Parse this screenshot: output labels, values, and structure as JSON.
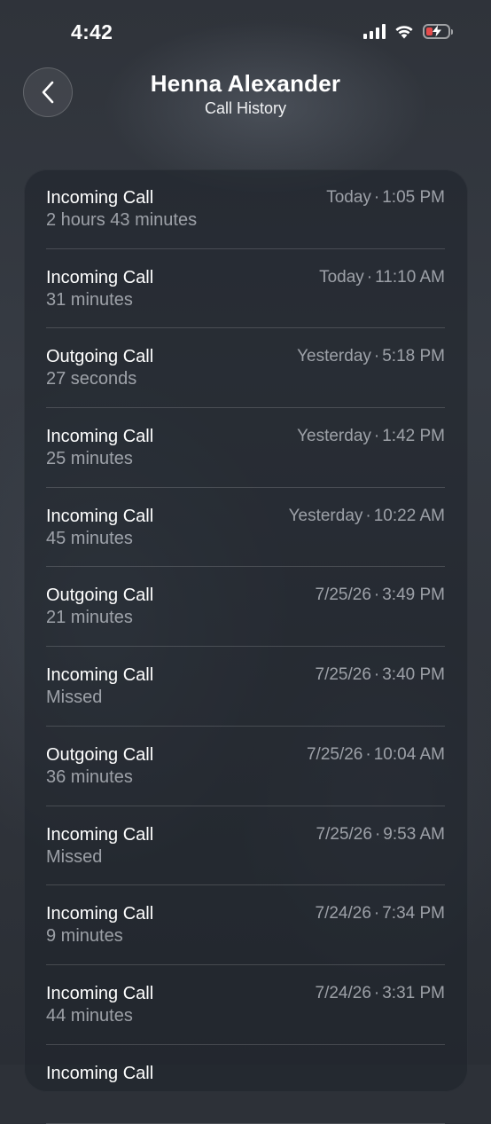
{
  "status_bar": {
    "time": "4:42",
    "battery_color": "#e64b4b"
  },
  "header": {
    "back_icon": "chevron-left-icon",
    "title": "Henna Alexander",
    "subtitle": "Call History"
  },
  "calls": [
    {
      "type": "Incoming Call",
      "detail": "2 hours 43 minutes",
      "day": "Today",
      "time": "1:05 PM"
    },
    {
      "type": "Incoming Call",
      "detail": "31 minutes",
      "day": "Today",
      "time": "11:10 AM"
    },
    {
      "type": "Outgoing Call",
      "detail": "27 seconds",
      "day": "Yesterday",
      "time": "5:18 PM"
    },
    {
      "type": "Incoming Call",
      "detail": "25 minutes",
      "day": "Yesterday",
      "time": "1:42 PM"
    },
    {
      "type": "Incoming Call",
      "detail": "45 minutes",
      "day": "Yesterday",
      "time": "10:22 AM"
    },
    {
      "type": "Outgoing Call",
      "detail": "21 minutes",
      "day": "7/25/26",
      "time": "3:49 PM"
    },
    {
      "type": "Incoming Call",
      "detail": "Missed",
      "day": "7/25/26",
      "time": "3:40 PM"
    },
    {
      "type": "Outgoing Call",
      "detail": "36 minutes",
      "day": "7/25/26",
      "time": "10:04 AM"
    },
    {
      "type": "Incoming Call",
      "detail": "Missed",
      "day": "7/25/26",
      "time": "9:53 AM"
    },
    {
      "type": "Incoming Call",
      "detail": "9 minutes",
      "day": "7/24/26",
      "time": "7:34 PM"
    },
    {
      "type": "Incoming Call",
      "detail": "44 minutes",
      "day": "7/24/26",
      "time": "3:31 PM"
    },
    {
      "type": "Incoming Call",
      "detail": "",
      "day": "",
      "time": ""
    }
  ]
}
